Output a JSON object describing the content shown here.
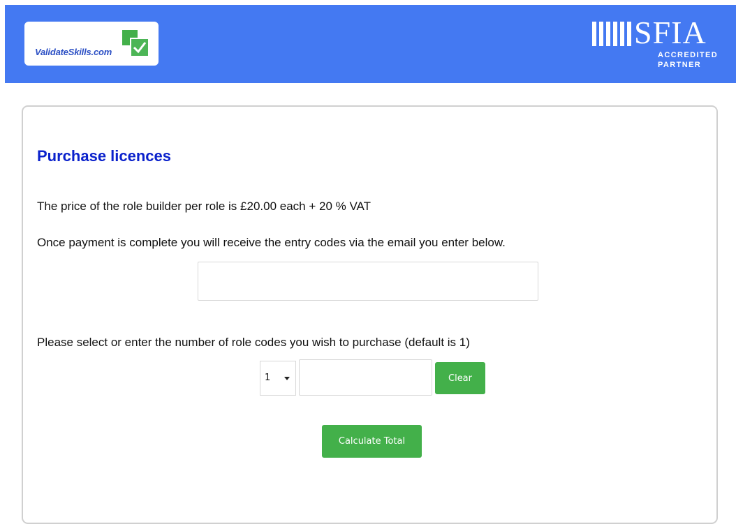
{
  "header": {
    "logo_text": "ValidateSkills.com",
    "partner_word": "SFIA",
    "partner_line1": "ACCREDITED",
    "partner_line2": "PARTNER",
    "brand_color": "#4479f2",
    "logo_green": "#43b04a"
  },
  "purchase": {
    "title": "Purchase licences",
    "price_text": "The price of the role builder per role is £20.00 each + 20 % VAT",
    "email_info": "Once payment is complete you will receive the entry codes via the email you enter below.",
    "email_value": "",
    "quantity_prompt": "Please select or enter the number of role codes you wish to purchase (default is 1)",
    "quantity_select_value": "1",
    "quantity_input_value": "",
    "clear_label": "Clear",
    "calculate_label": "Calculate Total",
    "title_color": "#0b22cc",
    "button_color": "#43b04a"
  },
  "icons": {
    "logo_mark": "checkbox-check-icon",
    "select_arrow": "caret-down-icon",
    "partner_mark": "vertical-bars-icon"
  }
}
